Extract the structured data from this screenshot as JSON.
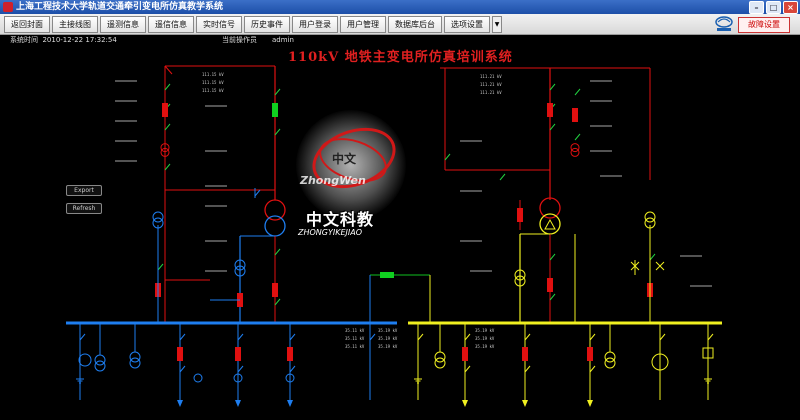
{
  "window": {
    "title": "上海工程技术大学轨道交通牵引变电所仿真教学系统"
  },
  "menu": {
    "items": [
      "返回封面",
      "主接线图",
      "遥测信息",
      "遥信信息",
      "实时信号",
      "历史事件",
      "用户登录",
      "用户管理",
      "数据库后台",
      "选项设置"
    ],
    "fault_button": "故障设置"
  },
  "status": {
    "system_time_label": "系统时间",
    "system_time": "2010-12-22  17:32:54",
    "operator_label": "当前操作员",
    "operator": "admin"
  },
  "page_title": "110kV 地铁主变电所仿真培训系统",
  "side_buttons": {
    "export": "Export",
    "refresh": "Refresh"
  },
  "watermark": {
    "logo_text": "中文",
    "logo_en": "ZhongWen",
    "brand": "中文科教",
    "brand_en": "ZHONGYIKEJIAO"
  },
  "readings": {
    "left_top": [
      "111.15  kV",
      "111.15  kV",
      "111.15  kV"
    ],
    "right_top": [
      "111.21  kV",
      "111.21  kV",
      "111.21  kV"
    ],
    "bus_left": [
      "35.11  kV",
      "35.11  kV",
      "35.11  kV"
    ],
    "bus_mid": [
      "35.19  kV",
      "35.19  kV",
      "35.19  kV"
    ],
    "bus_right": [
      "35.19  kV",
      "35.19  kV",
      "35.19  kV"
    ]
  },
  "colors": {
    "hv": "#e01010",
    "mv_left": "#1e7ef0",
    "mv_right": "#f0f020",
    "breaker": "#e01010",
    "breaker_closed": "#10d020",
    "switch": "#20d040",
    "tie": "#10c020"
  }
}
